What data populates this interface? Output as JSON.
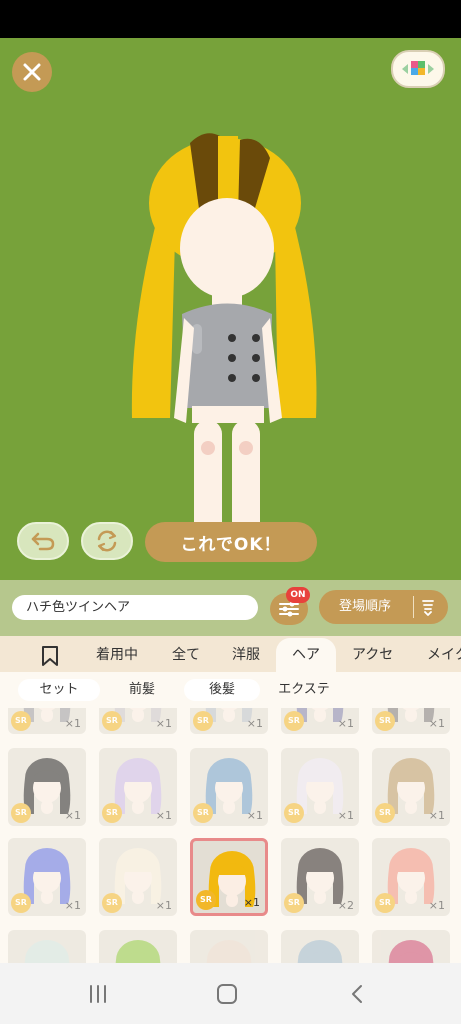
{
  "header": {
    "close_icon": "close-icon",
    "palette_icon": "color-palette-icon"
  },
  "stage": {
    "background_color": "#77a23a",
    "ok_label": "これでOK！",
    "undo_icon": "undo-icon",
    "reset_icon": "refresh-icon"
  },
  "search": {
    "value": "ハチ色ツインヘア",
    "filter_badge": "ON",
    "sort_label": "登場順序"
  },
  "tabs": [
    {
      "label": "着用中"
    },
    {
      "label": "全て"
    },
    {
      "label": "洋服"
    },
    {
      "label": "ヘア"
    },
    {
      "label": "アクセ"
    },
    {
      "label": "メイク"
    }
  ],
  "subtabs": [
    {
      "label": "セット"
    },
    {
      "label": "前髪"
    },
    {
      "label": "後髪"
    },
    {
      "label": "エクステ"
    }
  ],
  "items": [
    {
      "rarity": "SR",
      "count": "×1",
      "hair_color": "#9a9aa0"
    },
    {
      "rarity": "SR",
      "count": "×1",
      "hair_color": "#c8c3c8"
    },
    {
      "rarity": "SR",
      "count": "×1",
      "hair_color": "#b9bfc8"
    },
    {
      "rarity": "SR",
      "count": "×1",
      "hair_color": "#7f7fa8"
    },
    {
      "rarity": "SR",
      "count": "×1",
      "hair_color": "#7c7878"
    },
    {
      "rarity": "SR",
      "count": "×1",
      "hair_color": "#222222"
    },
    {
      "rarity": "SR",
      "count": "×1",
      "hair_color": "#c9b7e6"
    },
    {
      "rarity": "SR",
      "count": "×1",
      "hair_color": "#6f9ec8"
    },
    {
      "rarity": "SR",
      "count": "×1",
      "hair_color": "#e9e2ef"
    },
    {
      "rarity": "SR",
      "count": "×1",
      "hair_color": "#b99863"
    },
    {
      "rarity": "SR",
      "count": "×1",
      "hair_color": "#5e6fe0"
    },
    {
      "rarity": "SR",
      "count": "×1",
      "hair_color": "#f4ecd8"
    },
    {
      "rarity": "SR",
      "count": "×1",
      "hair_color": "#f2b90f",
      "selected": true
    },
    {
      "rarity": "SR",
      "count": "×2",
      "hair_color": "#2a2220"
    },
    {
      "rarity": "SR",
      "count": "×1",
      "hair_color": "#f08e7c"
    },
    {
      "rarity": "",
      "count": "",
      "hair_color": "#cfe2de"
    },
    {
      "rarity": "",
      "count": "",
      "hair_color": "#8cc63b"
    },
    {
      "rarity": "",
      "count": "",
      "hair_color": "#e6d6c8"
    },
    {
      "rarity": "",
      "count": "",
      "hair_color": "#9ab5c7"
    },
    {
      "rarity": "",
      "count": "",
      "hair_color": "#c8446a"
    }
  ],
  "nav": {
    "recent_icon": "recent-apps-icon",
    "home_icon": "home-icon",
    "back_icon": "back-icon"
  }
}
